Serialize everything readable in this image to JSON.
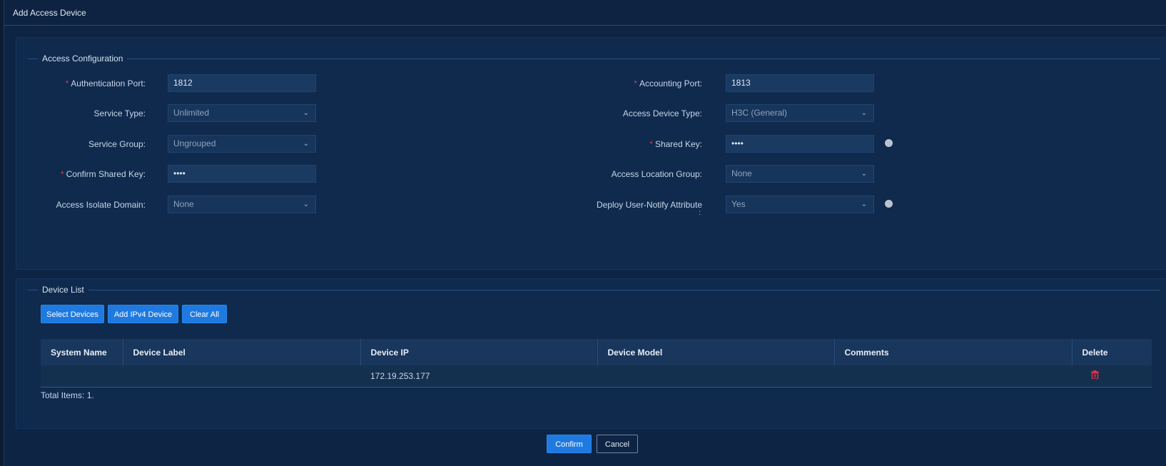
{
  "dialog": {
    "title": "Add Access Device"
  },
  "config": {
    "legend": "Access Configuration",
    "left": [
      {
        "label": "Authentication Port:",
        "required": true,
        "value": "1812",
        "type": "input"
      },
      {
        "label": "Service Type:",
        "required": false,
        "value": "Unlimited",
        "type": "select"
      },
      {
        "label": "Service Group:",
        "required": false,
        "value": "Ungrouped",
        "type": "select"
      },
      {
        "label": "Confirm Shared Key:",
        "required": true,
        "value": "••••",
        "type": "password"
      },
      {
        "label": "Access Isolate Domain:",
        "required": false,
        "value": "None",
        "type": "select"
      }
    ],
    "right": [
      {
        "label": "Accounting Port:",
        "required": true,
        "value": "1813",
        "type": "input"
      },
      {
        "label": "Access Device Type:",
        "required": false,
        "value": "H3C (General)",
        "type": "select"
      },
      {
        "label": "Shared Key:",
        "required": true,
        "value": "••••",
        "type": "password",
        "info": true
      },
      {
        "label": "Access Location Group:",
        "required": false,
        "value": "None",
        "type": "select"
      },
      {
        "label": "Deploy User-Notify Attribute",
        "label_suffix": ":",
        "required": false,
        "value": "Yes",
        "type": "select",
        "info": true
      }
    ]
  },
  "devices": {
    "legend": "Device List",
    "buttons": {
      "select": "Select Devices",
      "add_ipv4": "Add IPv4 Device",
      "clear": "Clear All"
    },
    "columns": [
      "System Name",
      "Device Label",
      "Device IP",
      "Device Model",
      "Comments",
      "Delete"
    ],
    "rows": [
      {
        "system_name": "",
        "device_label": "",
        "device_ip": "172.19.253.177",
        "device_model": "",
        "comments": "",
        "delete_icon": "trash-icon"
      }
    ],
    "total": "Total Items: 1."
  },
  "footer": {
    "confirm": "Confirm",
    "cancel": "Cancel"
  },
  "colors": {
    "accent": "#1e7ae0",
    "required": "#e0344a",
    "background": "#0e2444"
  }
}
